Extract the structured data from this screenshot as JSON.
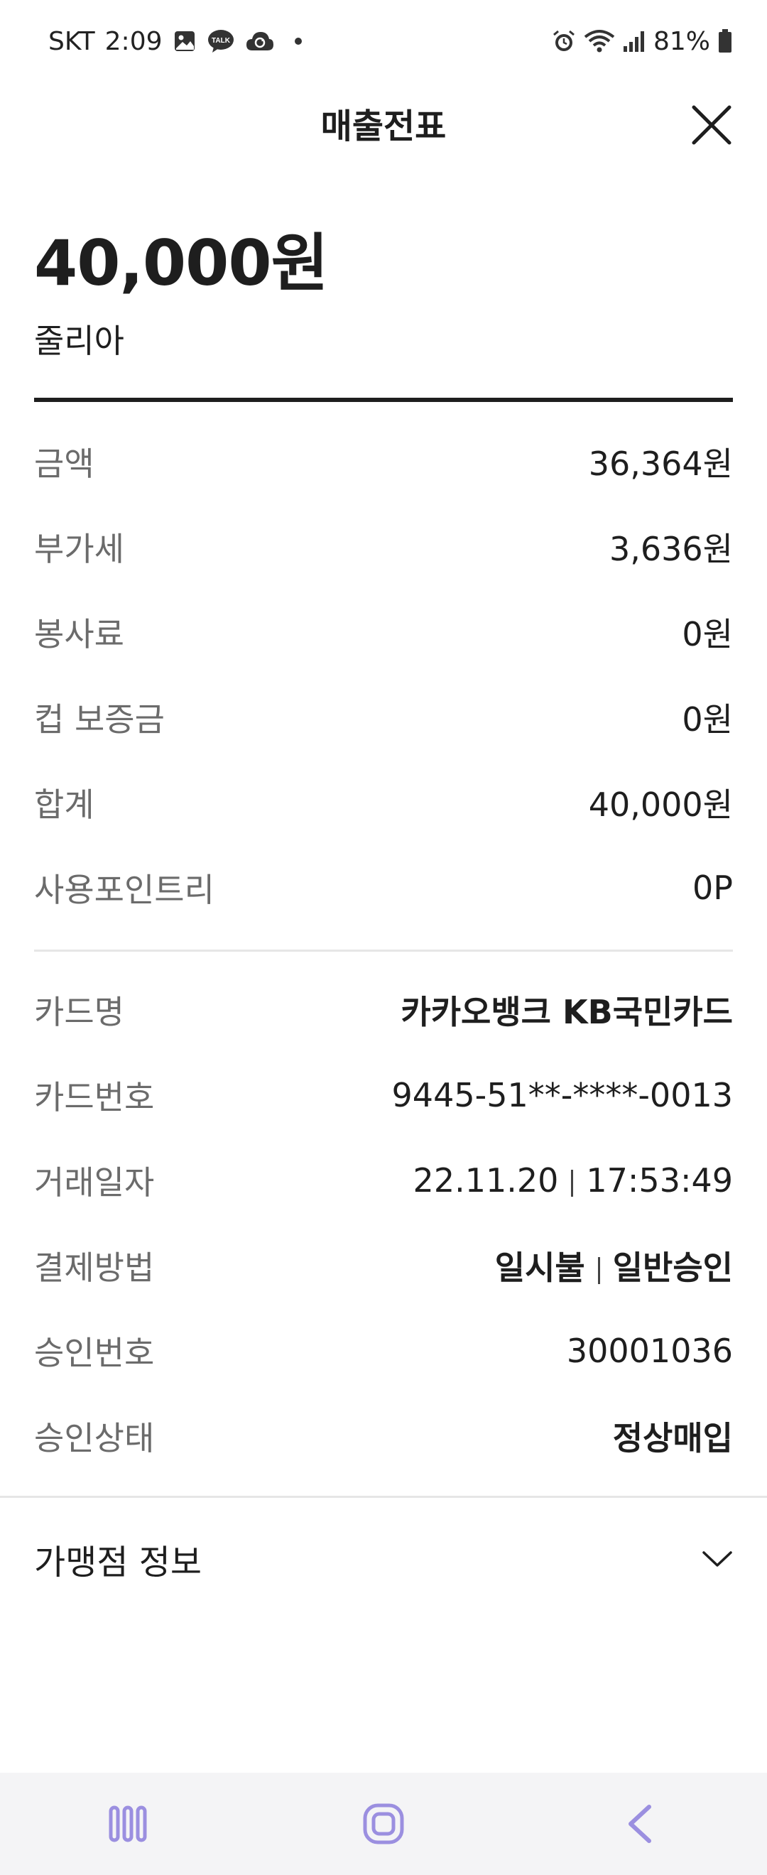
{
  "status_bar": {
    "carrier": "SKT",
    "time": "2:09",
    "talk_badge": "TALK",
    "battery_percent": "81%"
  },
  "header": {
    "title": "매출전표"
  },
  "summary": {
    "amount": "40,000원",
    "merchant": "줄리아"
  },
  "charges": [
    {
      "label": "금액",
      "value": "36,364원"
    },
    {
      "label": "부가세",
      "value": "3,636원"
    },
    {
      "label": "봉사료",
      "value": "0원"
    },
    {
      "label": "컵 보증금",
      "value": "0원"
    },
    {
      "label": "합계",
      "value": "40,000원"
    },
    {
      "label": "사용포인트리",
      "value": "0P"
    }
  ],
  "card_info": {
    "card_name": {
      "label": "카드명",
      "value": "카카오뱅크 KB국민카드"
    },
    "card_number": {
      "label": "카드번호",
      "value": "9445-51**-****-0013"
    },
    "transaction_date": {
      "label": "거래일자",
      "date": "22.11.20",
      "time": "17:53:49"
    },
    "payment_method": {
      "label": "결제방법",
      "type": "일시불",
      "approval_type": "일반승인"
    },
    "approval_number": {
      "label": "승인번호",
      "value": "30001036"
    },
    "approval_status": {
      "label": "승인상태",
      "value": "정상매입"
    }
  },
  "merchant_info": {
    "label": "가맹점 정보"
  },
  "icons": {
    "close": "close-icon",
    "expand": "chevron-down-icon",
    "nav_recents": "recents-icon",
    "nav_home": "home-icon",
    "nav_back": "back-icon"
  },
  "colors": {
    "text_primary": "#1e1e1e",
    "text_secondary": "#6b6b6b",
    "nav_icon": "#9b8fe0"
  }
}
